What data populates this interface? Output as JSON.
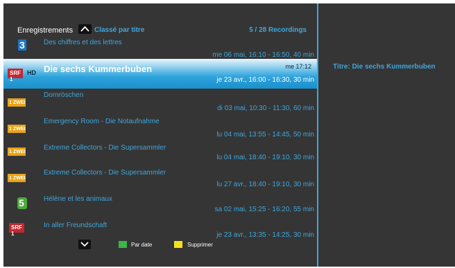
{
  "header": {
    "title": "Enregistrements",
    "sort_label": "Classé par titre",
    "count": "5 / 28 Recordings"
  },
  "recordings": [
    {
      "logo": "3",
      "channel_icon": "tv3-logo-icon",
      "title": "Des chiffres et des lettres",
      "date": "me 06 mai, 16:10 - 16:50, 40 min"
    },
    {
      "logo": "HD",
      "channel_icon": "srf1-hd-logo-icon",
      "title": "Die sechs Kummerbuben",
      "time": "me 17:12",
      "date": "je 23 avr., 16:00 - 16:30, 30 min",
      "selected": true
    },
    {
      "logo": "zwei",
      "channel_icon": "zwei-logo-icon",
      "title": "Dornröschen",
      "date": "di 03 mai, 10:30 - 11:30, 60 min"
    },
    {
      "logo": "zwei",
      "channel_icon": "zwei-logo-icon",
      "title": "Emergency Room - Die Notaufnahme",
      "date": "lu 04 mai, 13:55 - 14:45, 50 min"
    },
    {
      "logo": "zwei",
      "channel_icon": "zwei-logo-icon",
      "title": "Extreme Collectors - Die Supersammler",
      "date": "lu 04 mai, 18:40 - 19:10, 30 min"
    },
    {
      "logo": "zwei",
      "channel_icon": "zwei-logo-icon",
      "title": "Extreme Collectors - Die Supersammler",
      "date": "lu 27 avr., 18:40 - 19:10, 30 min"
    },
    {
      "logo": "5",
      "channel_icon": "france5-logo-icon",
      "title": "Hélène et les animaux",
      "date": "sa 02 mai, 15:25 - 16:20, 55 min"
    },
    {
      "logo": "1",
      "channel_icon": "srf1-logo-icon",
      "title": "In aller Freundschaft",
      "date": "je 23 avr., 13:35 - 14:25, 30 min"
    }
  ],
  "footer": {
    "green_label": "Par date",
    "yellow_label": "Supprimer",
    "green_color": "#3cb54a",
    "yellow_color": "#f2e01c"
  },
  "detail": {
    "title": "Titre: Die sechs Kummerbuben"
  },
  "colors": {
    "accent": "#3fa7dc",
    "background": "#353535"
  }
}
